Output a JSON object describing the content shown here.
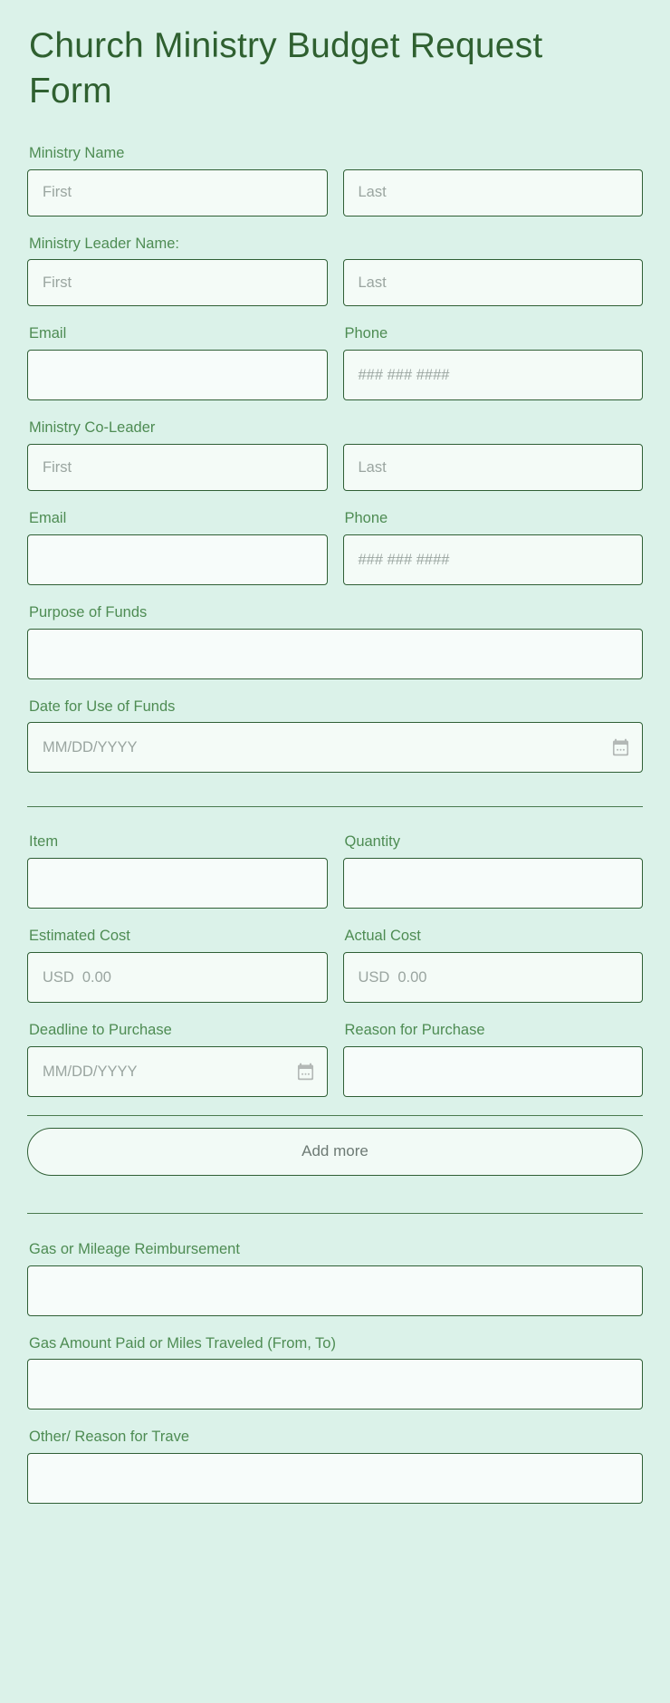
{
  "page": {
    "title": "Church Ministry Budget Request Form",
    "background_color": "#dbf2e9",
    "title_color": "#2f6030",
    "label_color": "#4e8c53",
    "input_border_color": "#2f5f35",
    "input_fill_color": "#f4fbf7",
    "placeholder_color": "#9aa5a0"
  },
  "sections": {
    "contact": {
      "ministry_name": {
        "label": "Ministry Name",
        "first": {
          "placeholder": "First",
          "value": ""
        },
        "last": {
          "placeholder": "Last",
          "value": ""
        }
      },
      "ministry_leader_name": {
        "label": "Ministry Leader Name:",
        "first": {
          "placeholder": "First",
          "value": ""
        },
        "last": {
          "placeholder": "Last",
          "value": ""
        }
      },
      "leader_email": {
        "label": "Email",
        "placeholder": "",
        "value": ""
      },
      "leader_phone": {
        "label": "Phone",
        "placeholder": "### ### ####",
        "value": ""
      },
      "ministry_co_leader": {
        "label": "Ministry Co-Leader",
        "first": {
          "placeholder": "First",
          "value": ""
        },
        "last": {
          "placeholder": "Last",
          "value": ""
        }
      },
      "co_leader_email": {
        "label": "Email",
        "placeholder": "",
        "value": ""
      },
      "co_leader_phone": {
        "label": "Phone",
        "placeholder": "### ### ####",
        "value": ""
      },
      "purpose_of_funds": {
        "label": "Purpose of Funds",
        "placeholder": "",
        "value": ""
      },
      "date_for_use_of_funds": {
        "label": "Date for Use of Funds",
        "placeholder": "MM/DD/YYYY",
        "value": "",
        "icon": "calendar-icon"
      }
    },
    "line_item": {
      "item": {
        "label": "Item",
        "placeholder": "",
        "value": ""
      },
      "quantity": {
        "label": "Quantity",
        "placeholder": "",
        "value": ""
      },
      "estimated_cost": {
        "label": "Estimated Cost",
        "currency": "USD",
        "placeholder_amount": "0.00",
        "value": ""
      },
      "actual_cost": {
        "label": "Actual Cost",
        "currency": "USD",
        "placeholder_amount": "0.00",
        "value": ""
      },
      "deadline_to_purchase": {
        "label": "Deadline to Purchase",
        "placeholder": "MM/DD/YYYY",
        "value": "",
        "icon": "calendar-icon"
      },
      "reason_for_purchase": {
        "label": "Reason for Purchase",
        "placeholder": "",
        "value": ""
      },
      "add_more_label": "Add more"
    },
    "travel": {
      "gas_or_mileage_reimbursement": {
        "label": "Gas or Mileage Reimbursement",
        "placeholder": "",
        "value": ""
      },
      "gas_amount_or_miles": {
        "label": "Gas Amount Paid or Miles Traveled (From, To)",
        "placeholder": "",
        "value": ""
      },
      "other_reason_for_travel": {
        "label": "Other/ Reason for Trave",
        "placeholder": "",
        "value": ""
      }
    }
  }
}
